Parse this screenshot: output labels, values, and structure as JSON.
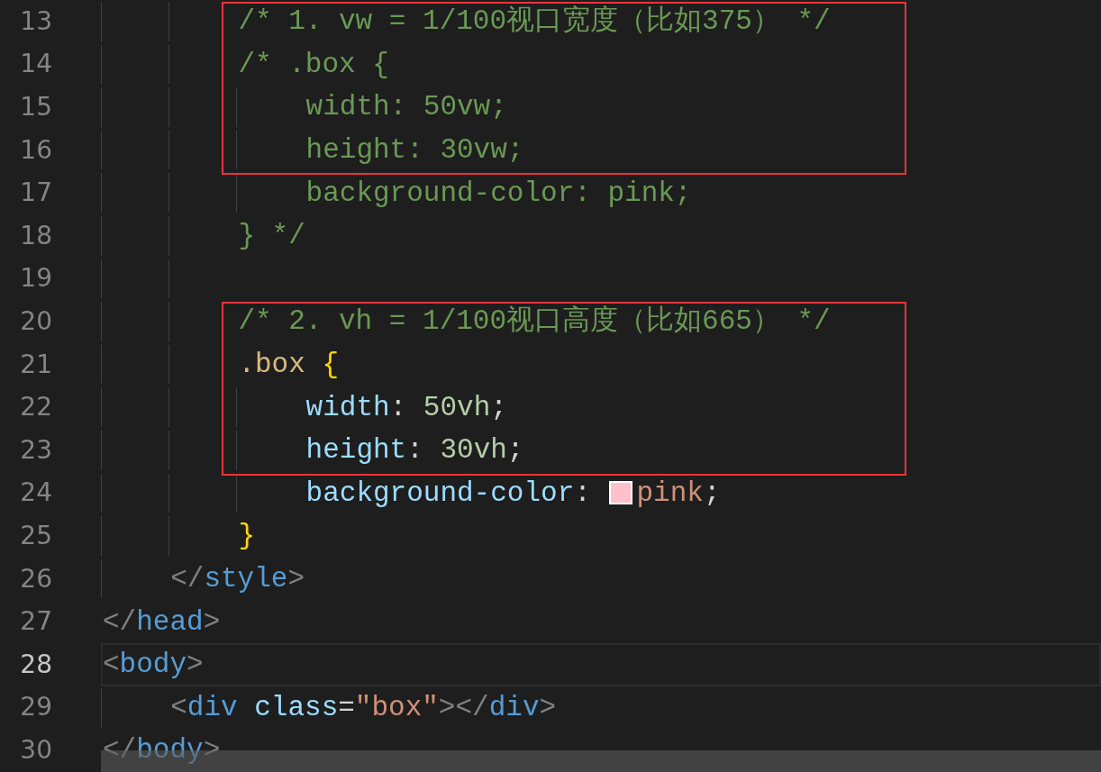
{
  "editor": {
    "lines": [
      {
        "number": "13",
        "current": false,
        "in_red_box": true,
        "tokens": [
          {
            "kind": "comment",
            "text": "        /* 1. vw = 1/100视口宽度（比如375） */"
          }
        ]
      },
      {
        "number": "14",
        "current": false,
        "in_red_box": true,
        "tokens": [
          {
            "kind": "comment",
            "text": "        /* .box {"
          }
        ]
      },
      {
        "number": "15",
        "current": false,
        "in_red_box": true,
        "tokens": [
          {
            "kind": "comment",
            "text": "            width: 50vw;"
          }
        ]
      },
      {
        "number": "16",
        "current": false,
        "in_red_box": true,
        "tokens": [
          {
            "kind": "comment",
            "text": "            height: 30vw;"
          }
        ]
      },
      {
        "number": "17",
        "current": false,
        "in_red_box": false,
        "tokens": [
          {
            "kind": "comment",
            "text": "            background-color: pink;"
          }
        ]
      },
      {
        "number": "18",
        "current": false,
        "in_red_box": false,
        "tokens": [
          {
            "kind": "comment",
            "text": "        } */"
          }
        ]
      },
      {
        "number": "19",
        "current": false,
        "in_red_box": false
      },
      {
        "number": "20",
        "current": false,
        "in_red_box": true,
        "tokens": [
          {
            "kind": "comment",
            "text": "        /* 2. vh = 1/100视口高度（比如665） */"
          }
        ]
      },
      {
        "number": "21",
        "current": false,
        "in_red_box": true,
        "tokens": [
          {
            "kind": "selector",
            "text": "        .box "
          },
          {
            "kind": "brace",
            "text": "{"
          }
        ]
      },
      {
        "number": "22",
        "current": false,
        "in_red_box": true,
        "tokens": [
          {
            "kind": "property",
            "text": "            width"
          },
          {
            "kind": "punct",
            "text": ": "
          },
          {
            "kind": "number",
            "text": "50vh"
          },
          {
            "kind": "punct",
            "text": ";"
          }
        ]
      },
      {
        "number": "23",
        "current": false,
        "in_red_box": true,
        "tokens": [
          {
            "kind": "property",
            "text": "            height"
          },
          {
            "kind": "punct",
            "text": ": "
          },
          {
            "kind": "number",
            "text": "30vh"
          },
          {
            "kind": "punct",
            "text": ";"
          }
        ]
      },
      {
        "number": "24",
        "current": false,
        "in_red_box": false,
        "tokens": [
          {
            "kind": "property",
            "text": "            background-color"
          },
          {
            "kind": "punct",
            "text": ": "
          },
          {
            "kind": "swatch",
            "color": "#ffc0cb"
          },
          {
            "kind": "value",
            "text": "pink"
          },
          {
            "kind": "punct",
            "text": ";"
          }
        ]
      },
      {
        "number": "25",
        "current": false,
        "in_red_box": false,
        "tokens": [
          {
            "kind": "brace",
            "text": "        }"
          }
        ]
      },
      {
        "number": "26",
        "current": false,
        "in_red_box": false,
        "tokens": [
          {
            "kind": "bracket",
            "text": "    </"
          },
          {
            "kind": "tag",
            "text": "style"
          },
          {
            "kind": "bracket",
            "text": ">"
          }
        ]
      },
      {
        "number": "27",
        "current": false,
        "in_red_box": false,
        "tokens": [
          {
            "kind": "bracket",
            "text": "</"
          },
          {
            "kind": "tag",
            "text": "head"
          },
          {
            "kind": "bracket",
            "text": ">"
          }
        ]
      },
      {
        "number": "28",
        "current": true,
        "in_red_box": false,
        "tokens": [
          {
            "kind": "bracket",
            "text": "<"
          },
          {
            "kind": "tag",
            "text": "body"
          },
          {
            "kind": "bracket",
            "text": ">"
          }
        ]
      },
      {
        "number": "29",
        "current": false,
        "in_red_box": false,
        "tokens": [
          {
            "kind": "bracket",
            "text": "    <"
          },
          {
            "kind": "tag",
            "text": "div "
          },
          {
            "kind": "attr",
            "text": "class"
          },
          {
            "kind": "punct",
            "text": "="
          },
          {
            "kind": "string",
            "text": "\"box\""
          },
          {
            "kind": "bracket",
            "text": "></"
          },
          {
            "kind": "tag",
            "text": "div"
          },
          {
            "kind": "bracket",
            "text": ">"
          }
        ]
      },
      {
        "number": "30",
        "current": false,
        "in_red_box": false,
        "tokens": [
          {
            "kind": "bracket",
            "text": "</"
          },
          {
            "kind": "tag",
            "text": "body"
          },
          {
            "kind": "bracket",
            "text": ">"
          }
        ]
      }
    ]
  }
}
